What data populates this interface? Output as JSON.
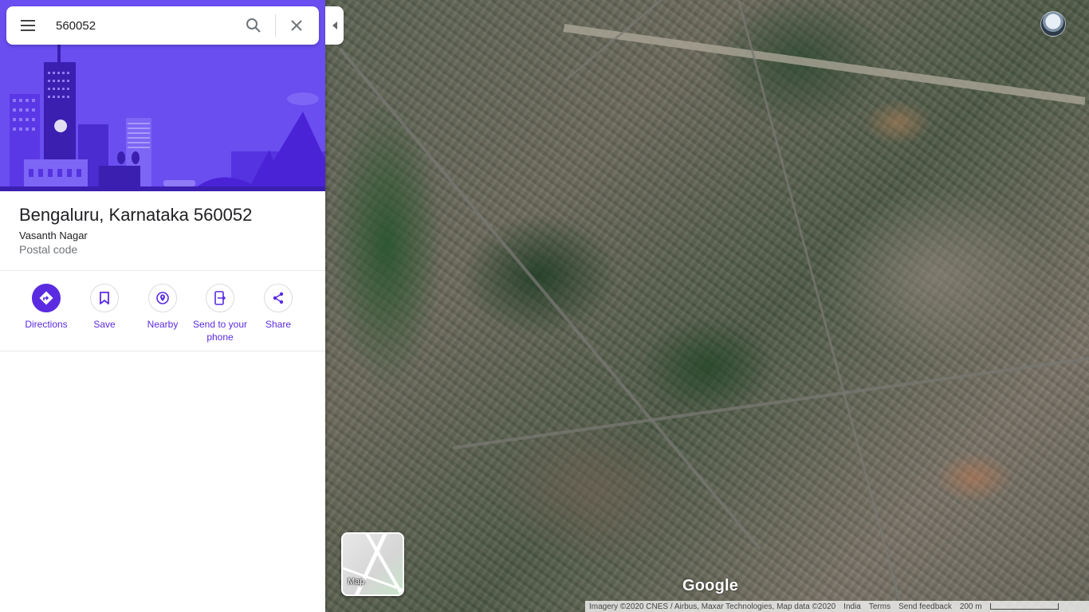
{
  "search": {
    "query": "560052"
  },
  "place": {
    "title": "Bengaluru, Karnataka 560052",
    "locality": "Vasanth Nagar",
    "category": "Postal code"
  },
  "actions": [
    {
      "label": "Directions"
    },
    {
      "label": "Save"
    },
    {
      "label": "Nearby"
    },
    {
      "label": "Send to your phone"
    },
    {
      "label": "Share"
    }
  ],
  "map": {
    "layer_toggle_label": "Map",
    "logo": "Google",
    "footer": {
      "attribution": "Imagery ©2020 CNES / Airbus, Maxar Technologies, Map data ©2020",
      "region": "India",
      "terms": "Terms",
      "feedback": "Send feedback",
      "scale": "200 m"
    }
  },
  "colors": {
    "accent": "#5a2be0",
    "hero_bg": "#6a4ef0"
  },
  "icons": [
    "menu-icon",
    "search-icon",
    "close-icon",
    "collapse-arrow-icon",
    "apps-grid-icon",
    "directions-icon",
    "bookmark-icon",
    "nearby-icon",
    "send-to-phone-icon",
    "share-icon",
    "globe-icon",
    "location-icon",
    "zoom-in-icon",
    "zoom-out-icon",
    "pegman-icon"
  ]
}
